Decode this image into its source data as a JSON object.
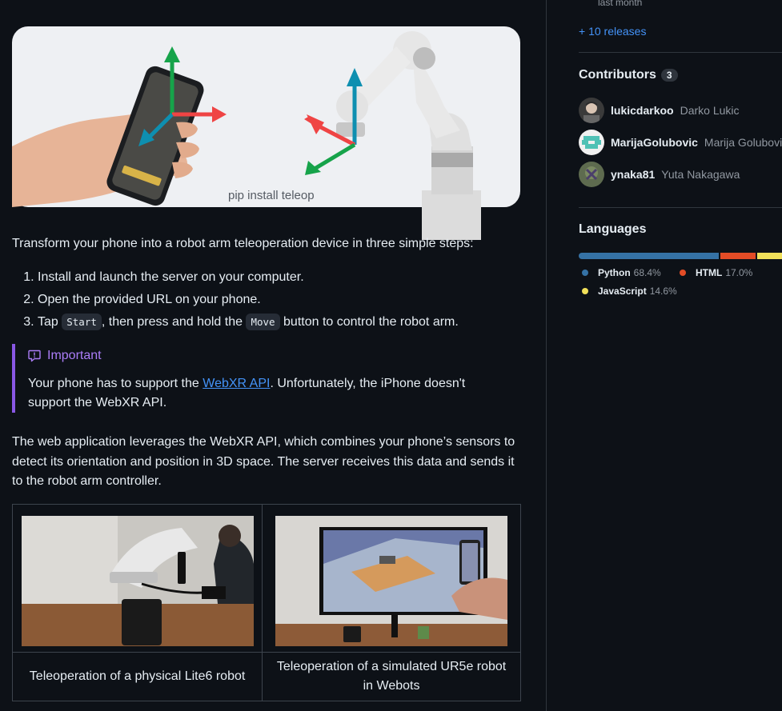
{
  "hero": {
    "caption": "pip install teleop"
  },
  "intro": "Transform your phone into a robot arm teleoperation device in three simple steps:",
  "steps": {
    "s1": "Install and launch the server on your computer.",
    "s2": "Open the provided URL on your phone.",
    "s3_pre": "Tap",
    "s3_code1": "Start",
    "s3_mid": ", then press and hold the",
    "s3_code2": "Move",
    "s3_post": "button to control the robot arm."
  },
  "alert": {
    "title": "Important",
    "body_pre": "Your phone has to support the",
    "link": "WebXR API",
    "body_post": ". Unfortunately, the iPhone doesn't support the WebXR API."
  },
  "paragraph2": "The web application leverages the WebXR API, which combines your phone’s sensors to detect its orientation and position in 3D space. The server receives this data and sends it to the robot arm controller.",
  "table": {
    "caption_left": "Teleoperation of a physical Lite6 robot",
    "caption_right": "Teleoperation of a simulated UR5e robot in Webots"
  },
  "sidebar": {
    "releases_sub": "last month",
    "releases_link": "+ 10 releases",
    "contributors": {
      "heading": "Contributors",
      "count": "3",
      "people": [
        {
          "login": "lukicdarkoo",
          "name": "Darko Lukic"
        },
        {
          "login": "MarijaGolubovic",
          "name": "Marija Golubovic"
        },
        {
          "login": "ynaka81",
          "name": "Yuta Nakagawa"
        }
      ]
    },
    "languages": {
      "heading": "Languages",
      "items": [
        {
          "name": "Python",
          "pct": "68.4%",
          "color": "#3572A5",
          "value": 68.4
        },
        {
          "name": "HTML",
          "pct": "17.0%",
          "color": "#e34c26",
          "value": 17.0
        },
        {
          "name": "JavaScript",
          "pct": "14.6%",
          "color": "#f1e05a",
          "value": 14.6
        }
      ]
    }
  },
  "colors": {
    "accent_link": "#4493f8",
    "important": "#8957e5",
    "bg": "#0d1117"
  }
}
